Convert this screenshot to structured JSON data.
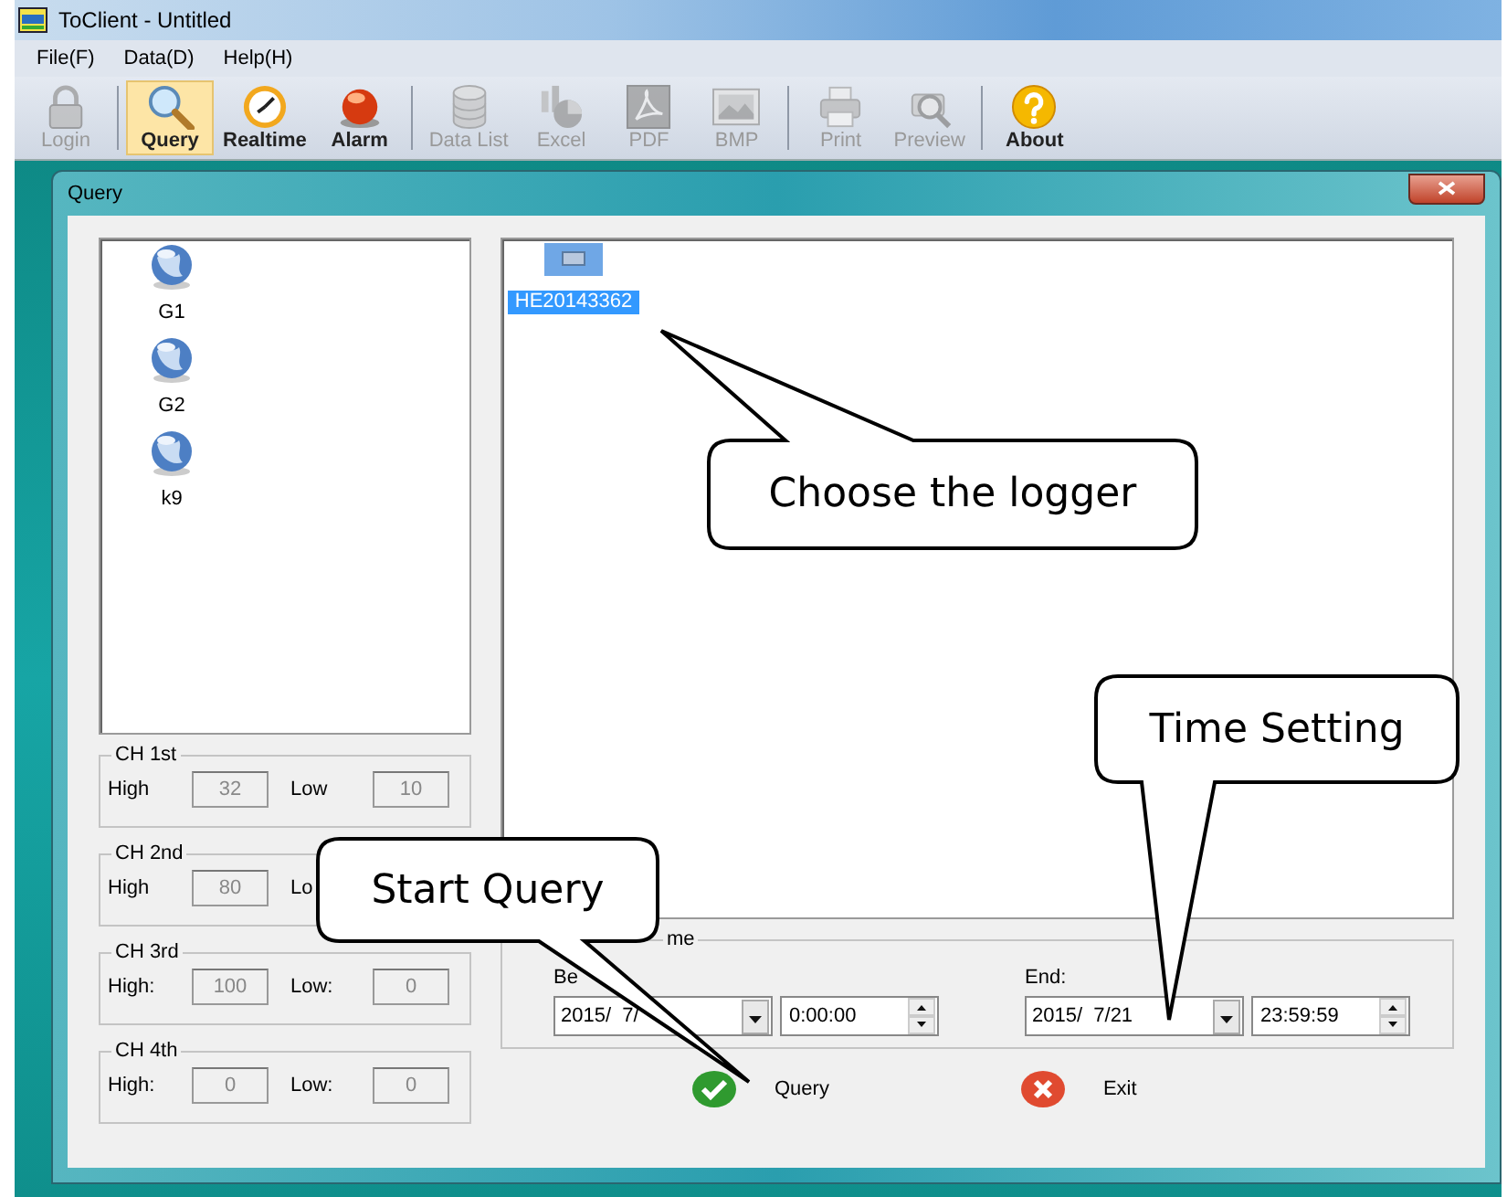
{
  "window": {
    "title": "ToClient - Untitled"
  },
  "menu": [
    {
      "label": "File(F)"
    },
    {
      "label": "Data(D)"
    },
    {
      "label": "Help(H)"
    }
  ],
  "toolbar": {
    "groups": [
      [
        {
          "label": "Login",
          "kind": "lock",
          "disabled": true,
          "selected": false
        }
      ],
      [
        {
          "label": "Query",
          "kind": "search",
          "disabled": false,
          "selected": true
        },
        {
          "label": "Realtime",
          "kind": "clock",
          "disabled": false,
          "selected": false
        },
        {
          "label": "Alarm",
          "kind": "alarm",
          "disabled": false,
          "selected": false
        }
      ],
      [
        {
          "label": "Data List",
          "kind": "database",
          "disabled": true,
          "selected": false
        },
        {
          "label": "Excel",
          "kind": "chart",
          "disabled": true,
          "selected": false
        },
        {
          "label": "PDF",
          "kind": "pdf",
          "disabled": true,
          "selected": false
        },
        {
          "label": "BMP",
          "kind": "image",
          "disabled": true,
          "selected": false
        }
      ],
      [
        {
          "label": "Print",
          "kind": "printer",
          "disabled": true,
          "selected": false
        },
        {
          "label": "Preview",
          "kind": "preview",
          "disabled": true,
          "selected": false
        }
      ],
      [
        {
          "label": "About",
          "kind": "help",
          "disabled": false,
          "selected": false
        }
      ]
    ]
  },
  "dialog": {
    "title": "Query",
    "groups": [
      {
        "label": "G1"
      },
      {
        "label": "G2"
      },
      {
        "label": "k9"
      }
    ],
    "loggers": [
      {
        "label": "HE20143362",
        "selected": true
      }
    ],
    "channels": [
      {
        "title": "CH 1st",
        "high_label": "High",
        "high": "32",
        "low_label": "Low",
        "low": "10"
      },
      {
        "title": "CH 2nd",
        "high_label": "High",
        "high": "80",
        "low_label": "Lo"
      },
      {
        "title": "CH 3rd",
        "high_label": "High:",
        "high": "100",
        "low_label": "Low:",
        "low": "0"
      },
      {
        "title": "CH 4th",
        "high_label": "High:",
        "high": "0",
        "low_label": "Low:",
        "low": "0"
      }
    ],
    "time": {
      "title": "me",
      "begin": {
        "label": "Be",
        "date": "2015/  7/",
        "time": "0:00:00"
      },
      "end": {
        "label": "End:",
        "date": "2015/  7/21",
        "time": "23:59:59"
      }
    },
    "buttons": [
      {
        "label": "Query",
        "kind": "ok"
      },
      {
        "label": "Exit",
        "kind": "cancel"
      }
    ]
  },
  "callouts": [
    {
      "text": "Choose the logger"
    },
    {
      "text": "Time Setting"
    },
    {
      "text": "Start Query"
    }
  ]
}
